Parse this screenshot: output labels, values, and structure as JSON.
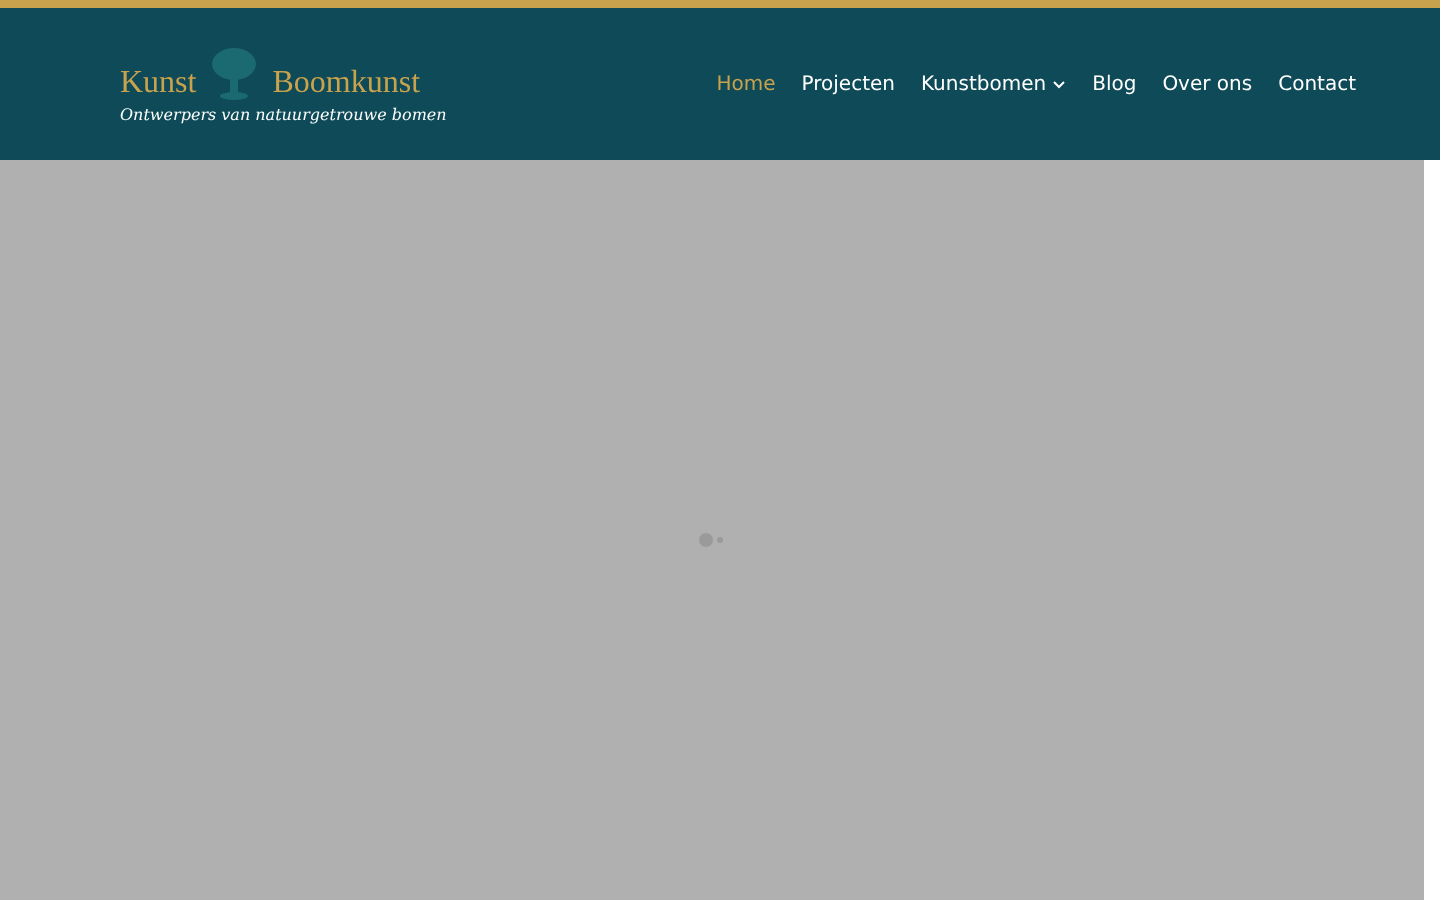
{
  "header": {
    "logo": {
      "word_left": "Kunst",
      "word_right": "Boomkunst",
      "tagline": "Ontwerpers van natuurgetrouwe bomen"
    },
    "nav": [
      {
        "label": "Home",
        "selected": true,
        "dropdown": false
      },
      {
        "label": "Projecten",
        "selected": false,
        "dropdown": false
      },
      {
        "label": "Kunstbomen",
        "selected": false,
        "dropdown": true
      },
      {
        "label": "Blog",
        "selected": false,
        "dropdown": false
      },
      {
        "label": "Over ons",
        "selected": false,
        "dropdown": false
      },
      {
        "label": "Contact",
        "selected": false,
        "dropdown": false
      }
    ]
  },
  "overlay": {
    "loading": true
  }
}
